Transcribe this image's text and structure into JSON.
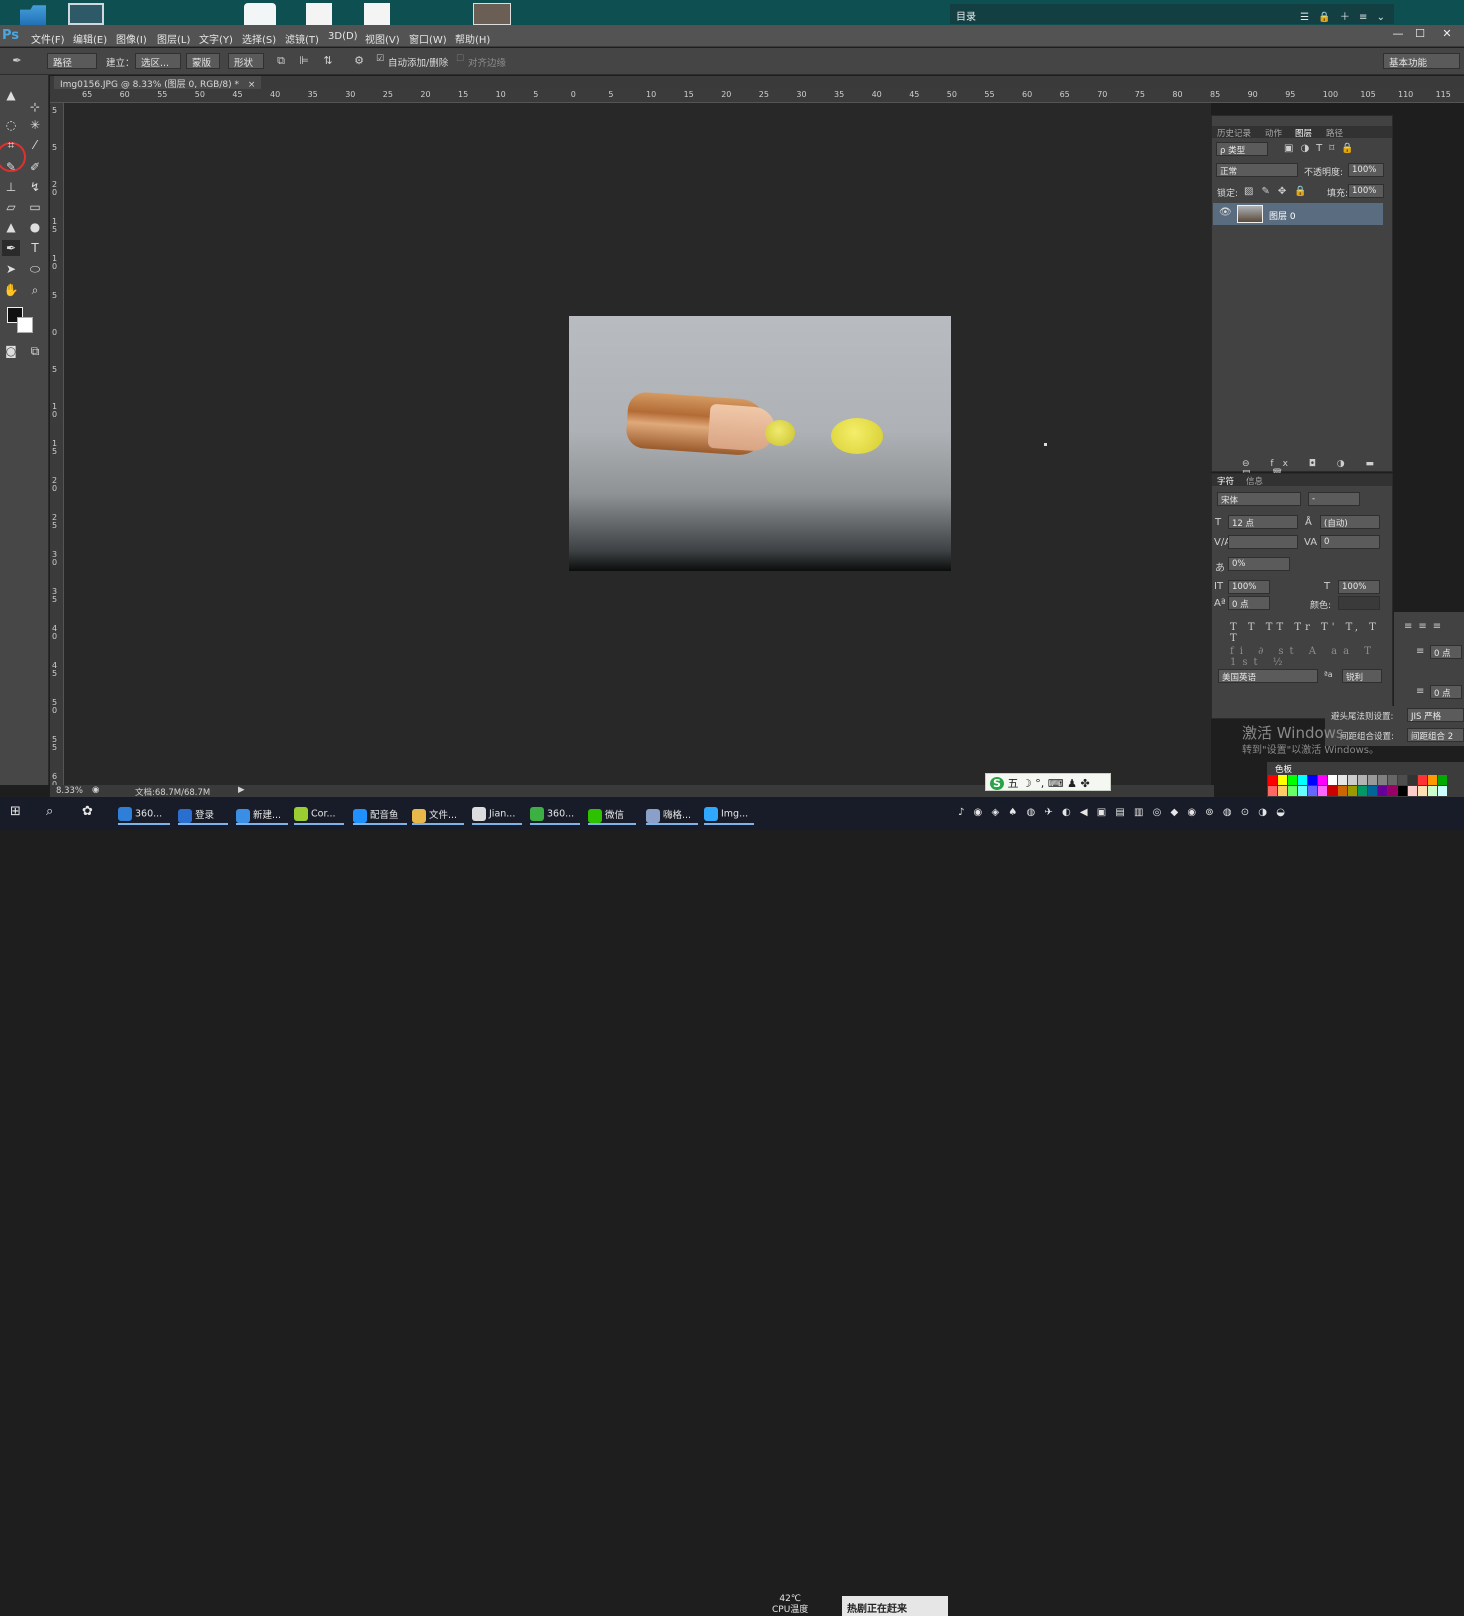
{
  "desktop": {
    "search_text": "目录",
    "search_tools": "☰ 🔒 ＋ ≡ ⌄"
  },
  "menu": {
    "logo": "Ps",
    "items": [
      "文件(F)",
      "编辑(E)",
      "图像(I)",
      "图层(L)",
      "文字(Y)",
      "选择(S)",
      "滤镜(T)",
      "3D(D)",
      "视图(V)",
      "窗口(W)",
      "帮助(H)"
    ],
    "window_buttons": [
      "—",
      "☐",
      "✕"
    ]
  },
  "options_bar": {
    "mode": "路径",
    "make_label": "建立：",
    "selection_btn": "选区...",
    "mask_btn": "蒙版",
    "shape_btn": "形状",
    "auto_add_delete": "自动添加/删除",
    "auto_add_checked": true,
    "align_edges": "对齐边缘",
    "align_edges_checked": false,
    "workspace": "基本功能"
  },
  "document": {
    "tab_title": "Img0156.JPG @ 8.33% (图层 0, RGB/8) *",
    "close": "×"
  },
  "rulers": {
    "h_labels": [
      "65",
      "60",
      "55",
      "50",
      "45",
      "40",
      "35",
      "30",
      "25",
      "20",
      "15",
      "10",
      "5",
      "0",
      "5",
      "10",
      "15",
      "20",
      "25",
      "30",
      "35",
      "40",
      "45",
      "50",
      "55",
      "60",
      "65",
      "70",
      "75",
      "80",
      "85",
      "90",
      "95",
      "100",
      "105",
      "110",
      "115"
    ],
    "v_labels": [
      "5",
      "5",
      "2 0",
      "1 5",
      "1 0",
      "5",
      "0",
      "5",
      "1 0",
      "1 5",
      "2 0",
      "2 5",
      "3 0",
      "3 5",
      "4 0",
      "4 5",
      "5 0",
      "5 5",
      "6 0"
    ]
  },
  "status_bar": {
    "zoom": "8.33%",
    "doc_size": "文档:68.7M/68.7M"
  },
  "layers_panel": {
    "tabs": [
      "历史记录",
      "动作",
      "图层",
      "路径"
    ],
    "active_tab": "图层",
    "filter_kind": "ρ 类型",
    "blend_mode": "正常",
    "opacity_label": "不透明度:",
    "opacity_value": "100%",
    "lock_label": "锁定:",
    "fill_label": "填充:",
    "fill_value": "100%",
    "layer_name": "图层 0",
    "footer_icons": "⊖ fx ◘ ◑ ▬ ▤ 🗑"
  },
  "character_panel": {
    "tabs": [
      "字符",
      "信息"
    ],
    "active_tab": "字符",
    "font_family": "宋体",
    "font_style": "-",
    "font_size": "12 点",
    "leading": "(自动)",
    "kerning": "",
    "tracking": "0",
    "tsume": "0%",
    "vscale": "100%",
    "hscale": "100%",
    "baseline": "0 点",
    "color_label": "颜色:",
    "style_buttons": "T T TT Tr T' T, T T",
    "opentype_buttons": "fi ∂ st A aa T 1st ½",
    "language": "美国英语",
    "aa_label": "ªa",
    "antialias": "锐利"
  },
  "paragraph_panel": {
    "indent_right": "0 点",
    "space_after": "0 点",
    "kinsoku_label": "避头尾法则设置:",
    "kinsoku_value": "JIS 严格",
    "mojikumi_label": "间距组合设置:",
    "mojikumi_value": "间距组合 2"
  },
  "swatches": {
    "tab": "色板",
    "colors": [
      "#ff0000",
      "#ffff00",
      "#00ff00",
      "#00ffff",
      "#0000ff",
      "#ff00ff",
      "#ffffff",
      "#e6e6e6",
      "#cccccc",
      "#b3b3b3",
      "#999999",
      "#808080",
      "#666666",
      "#4d4d4d",
      "#333333",
      "#ff3333",
      "#ff9900",
      "#00aa00",
      "#ff6666",
      "#ffcc66",
      "#66ff66",
      "#66ffff",
      "#6666ff",
      "#ff66ff",
      "#cc0000",
      "#cc6600",
      "#999900",
      "#009966",
      "#006699",
      "#660099",
      "#990066",
      "#000000",
      "#ffcccc",
      "#ffe0b3",
      "#ccffcc",
      "#ccffff",
      "#9999ff",
      "#ff99cc",
      "#cc9966",
      "#996633",
      "#663300",
      "#336600",
      "#006633",
      "#003366",
      "#330066",
      "#660033",
      "#ff9999",
      "#ffcc99",
      "#ffff99",
      "#99ff99",
      "#99ffff",
      "#99ccff",
      "#cc99ff",
      "#ff99ff",
      "#ff0066",
      "#ff6600",
      "#cccc00",
      "#33cc33",
      "#00cccc",
      "#3366cc",
      "#9933cc",
      "#cc3399",
      "#804000",
      "#408000",
      "#008040",
      "#004080",
      "#400080",
      "#800040",
      "#ffb3b3",
      "#b3ffb3",
      "#b3b3ff",
      "#f0f0f0"
    ]
  },
  "watermark": {
    "line1": "激活 Windows",
    "line2": "转到\"设置\"以激活 Windows。"
  },
  "ime": {
    "logo": "S",
    "text": "五 ☽ °, ⌨ ♟ ✤"
  },
  "taskbar": {
    "items": [
      {
        "label": "360...",
        "color": "#2f7fd8"
      },
      {
        "label": "登录",
        "color": "#2a6fd0"
      },
      {
        "label": "新建...",
        "color": "#3a8ee6"
      },
      {
        "label": "Cor...",
        "color": "#9acd32"
      },
      {
        "label": "配音鱼",
        "color": "#1e90ff"
      },
      {
        "label": "文件...",
        "color": "#e8b84a"
      },
      {
        "label": "Jian...",
        "color": "#dddddd"
      },
      {
        "label": "360...",
        "color": "#3cb043"
      },
      {
        "label": "微信",
        "color": "#2dc100"
      },
      {
        "label": "嗨格...",
        "color": "#8aa0c8"
      },
      {
        "label": "Img...",
        "color": "#31a8ff"
      }
    ],
    "cpu_temp": "42℃",
    "cpu_label": "CPU温度",
    "news": "热剧正在赶来"
  },
  "colors": {
    "accent": "#31a8ff",
    "layer_selected": "#5a6c80"
  }
}
